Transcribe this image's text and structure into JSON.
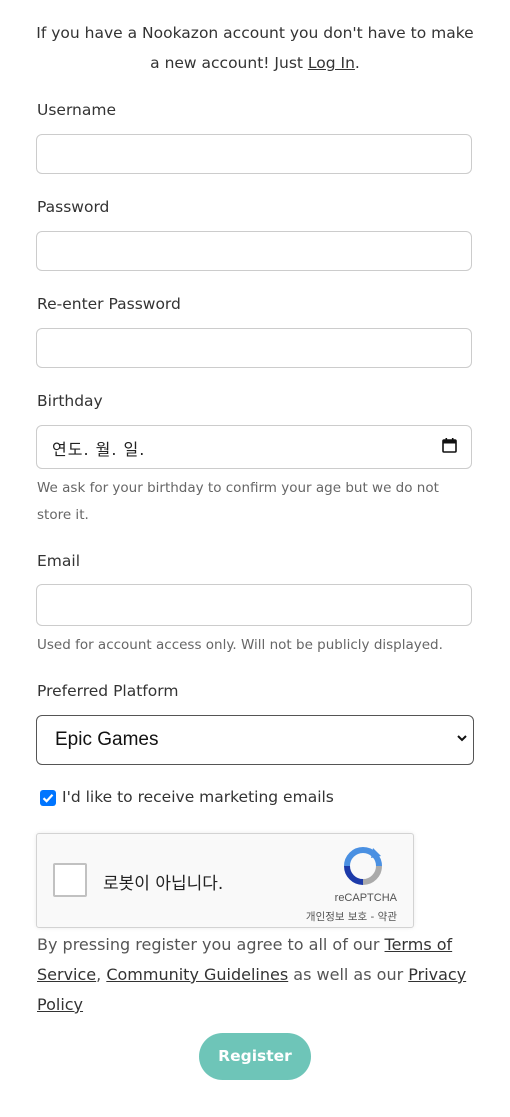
{
  "intro": {
    "text_before": "If you have a Nookazon account you don't have to make a new account! Just ",
    "login_link": "Log In",
    "text_after": "."
  },
  "form": {
    "username_label": "Username",
    "username_value": "",
    "password_label": "Password",
    "password_value": "",
    "reenter_label": "Re-enter Password",
    "reenter_value": "",
    "birthday_label": "Birthday",
    "birthday_placeholder": "연도. 월. 일.",
    "birthday_hint": "We ask for your birthday to confirm your age but we do not store it.",
    "email_label": "Email",
    "email_value": "",
    "email_hint": "Used for account access only. Will not be publicly displayed.",
    "platform_label": "Preferred Platform",
    "platform_selected": "Epic Games",
    "marketing_label": "I'd like to receive marketing emails",
    "marketing_checked": true
  },
  "captcha": {
    "label": "로봇이 아닙니다.",
    "brand": "reCAPTCHA",
    "links": "개인정보 보호 - 약관"
  },
  "terms": {
    "prefix": "By pressing register you agree to all of our ",
    "tos": "Terms of Service",
    "sep": ", ",
    "guidelines": "Community Guidelines",
    "middle": " as well as our ",
    "privacy": "Privacy Policy"
  },
  "register_label": "Register",
  "colors": {
    "accent": "#6ec5b8",
    "checkbox": "#0075ff"
  }
}
